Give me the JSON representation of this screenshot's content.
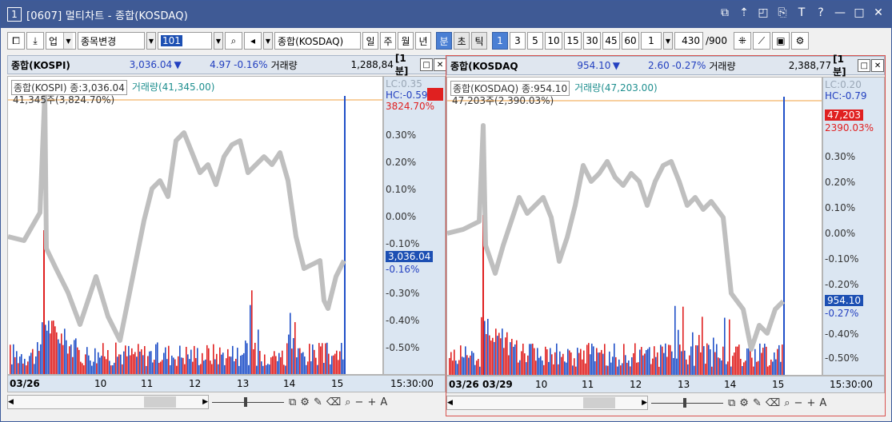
{
  "window": {
    "number": "1",
    "title": "[0607] 멀티차트 - 종합(KOSDAQ)",
    "controls": [
      "restore-icon",
      "pin-icon",
      "tile-icon",
      "copy-icon",
      "font-icon",
      "help-icon",
      "minimize-icon",
      "maximize-icon",
      "close-icon"
    ],
    "control_glyphs": [
      "⧉",
      "⇡",
      "◰",
      "⎘",
      "T",
      "?",
      "—",
      "□",
      "✕"
    ]
  },
  "toolbar": {
    "category": "업",
    "change_symbol": "종목변경",
    "code": "101",
    "market_name": "종합(KOSDAQ)",
    "periods": [
      "일",
      "주",
      "월",
      "년"
    ],
    "intervals": [
      "분",
      "초",
      "틱"
    ],
    "minute_options": [
      "1",
      "3",
      "5",
      "10",
      "15",
      "30",
      "45",
      "60"
    ],
    "selected_minute": "1",
    "multiplier": "1",
    "count": "430",
    "count_total": "/900"
  },
  "panes": [
    {
      "name": "종합(KOSPI)",
      "price": "3,036.04",
      "change": "4.97",
      "rate": "-0.16%",
      "volume_label": "거래량",
      "volume": "1,288,84",
      "period": "[1분]",
      "legend_price": "종합(KOSPI) 종:3,036.04",
      "legend_volume": "거래량(41,345.00)",
      "vol_max_label": "41,345주(3,824.70%)",
      "axis": {
        "lc": "LC:0.35",
        "hc": "HC:-0.59",
        "red_rate": "3824.70%",
        "ticks": [
          "0.30%",
          "0.20%",
          "0.10%",
          "0.00%",
          "-0.10%",
          "-0.30%",
          "-0.40%",
          "-0.50%"
        ],
        "price_box": "3,036.04",
        "price_rate": "-0.16%"
      },
      "x_labels": [
        "03/26",
        "10",
        "11",
        "12",
        "13",
        "14",
        "15"
      ],
      "time": "15:30:00"
    },
    {
      "name": "종합(KOSDAQ",
      "price": "954.10",
      "change": "2.60",
      "rate": "-0.27%",
      "volume_label": "거래량",
      "volume": "2,388,77",
      "period": "[1분]",
      "legend_price": "종합(KOSDAQ) 종:954.10",
      "legend_volume": "거래량(47,203.00)",
      "vol_max_label": "47,203주(2,390.03%)",
      "axis": {
        "lc": "LC:0.20",
        "hc": "HC:-0.79",
        "red_value": "47,203",
        "red_rate": "2390.03%",
        "ticks": [
          "0.30%",
          "0.20%",
          "0.10%",
          "0.00%",
          "-0.10%",
          "-0.20%",
          "-0.30%",
          "-0.40%",
          "-0.50%"
        ],
        "price_box": "954.10",
        "price_rate": "-0.27%"
      },
      "x_labels": [
        "03/26",
        "03/29",
        "10",
        "11",
        "12",
        "13",
        "14",
        "15"
      ],
      "time": "15:30:00"
    }
  ],
  "colors": {
    "titlebar": "#3f5a95",
    "price_line": "#bfbfbf",
    "volume_up": "#e02020",
    "volume_down": "#2050c8",
    "axis_bg": "#dbe6f2",
    "hc_line": "#f0a040"
  }
}
